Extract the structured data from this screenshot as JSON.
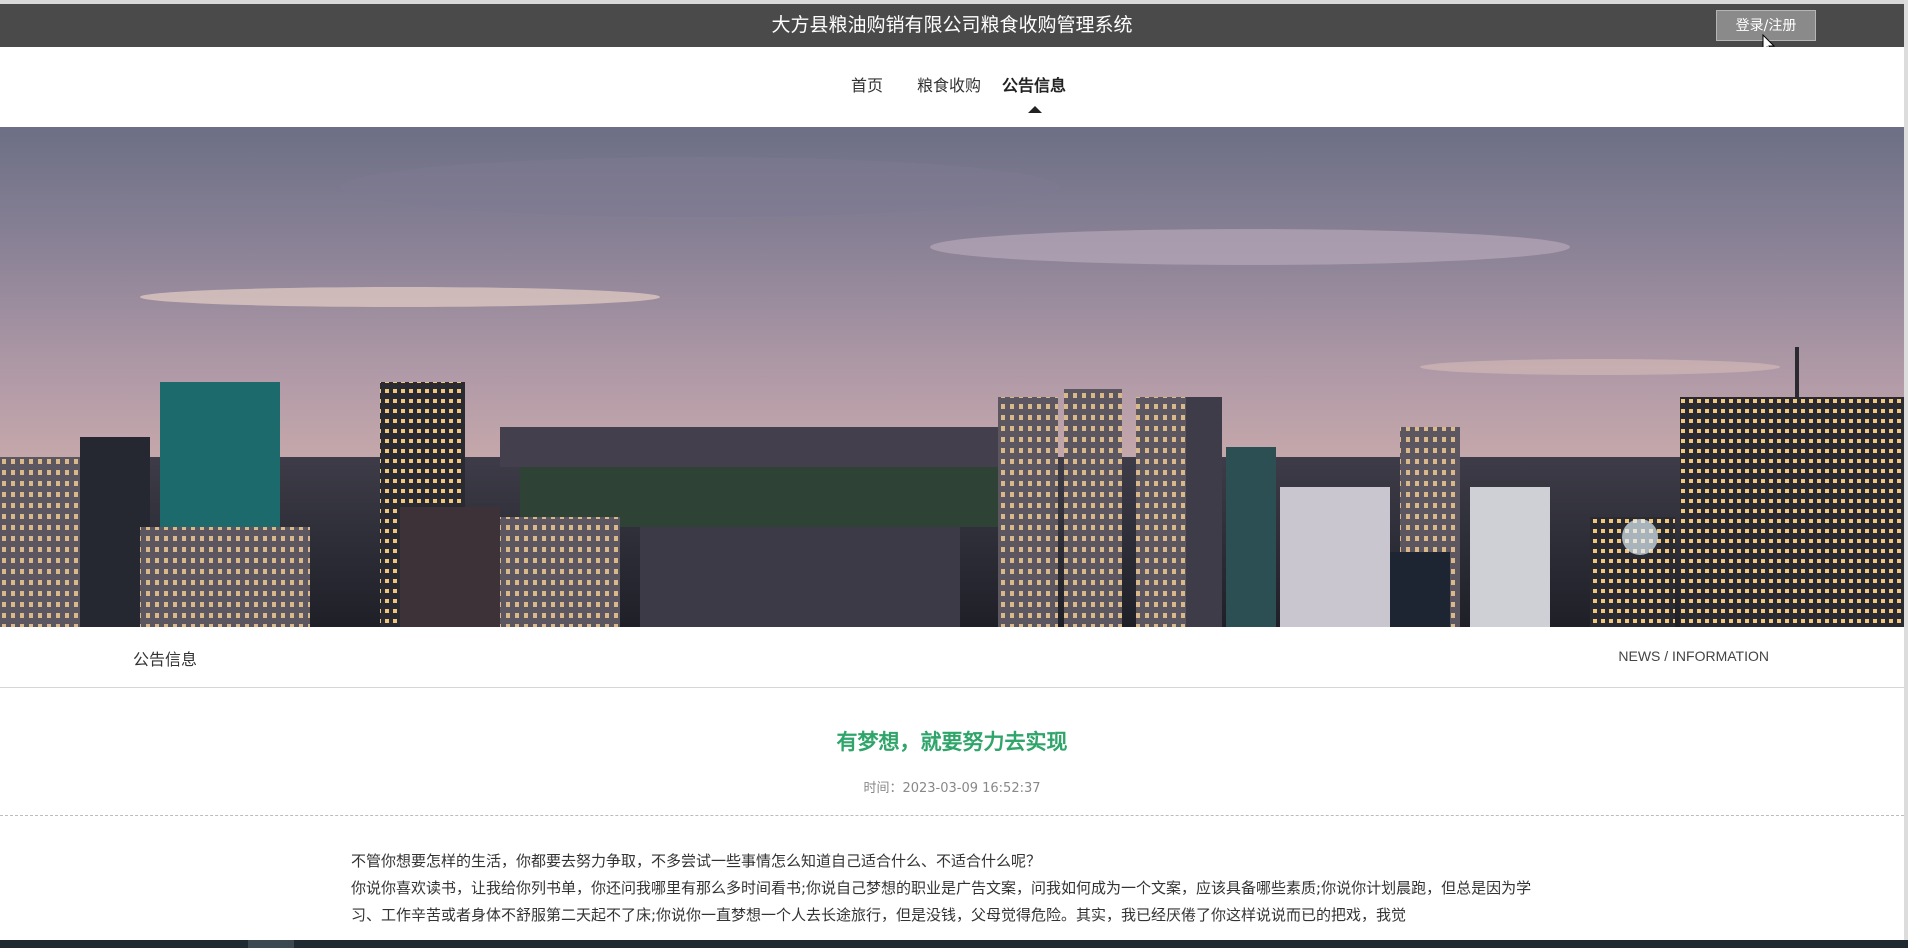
{
  "header": {
    "site_title": "大方县粮油购销有限公司粮食收购管理系统",
    "login_label": "登录/注册",
    "background": "#4a4a4a"
  },
  "nav": {
    "items": [
      {
        "label": "首页",
        "active": false
      },
      {
        "label": "粮食收购",
        "active": false
      },
      {
        "label": "公告信息",
        "active": true
      }
    ]
  },
  "banner": {
    "subject": "city-skyline-at-dusk"
  },
  "section": {
    "title": "公告信息",
    "subtitle": "NEWS / INFORMATION"
  },
  "article": {
    "title": "有梦想，就要努力去实现",
    "time": "时间：2023-03-09 16:52:37",
    "title_color": "#2fa56a",
    "paragraphs": [
      "不管你想要怎样的生活，你都要去努力争取，不多尝试一些事情怎么知道自己适合什么、不适合什么呢？",
      "你说你喜欢读书，让我给你列书单，你还问我哪里有那么多时间看书;你说自己梦想的职业是广告文案，问我如何成为一个文案，应该具备哪些素质;你说你计划晨跑，但总是因为学习、工作辛苦或者身体不舒服第二天起不了床;你说你一直梦想一个人去长途旅行，但是没钱，父母觉得危险。其实，我已经厌倦了你这样说说而已的把戏，我觉"
    ]
  },
  "icons": {
    "cursor": "mouse-pointer-icon",
    "nav_caret": "caret-up-icon"
  }
}
